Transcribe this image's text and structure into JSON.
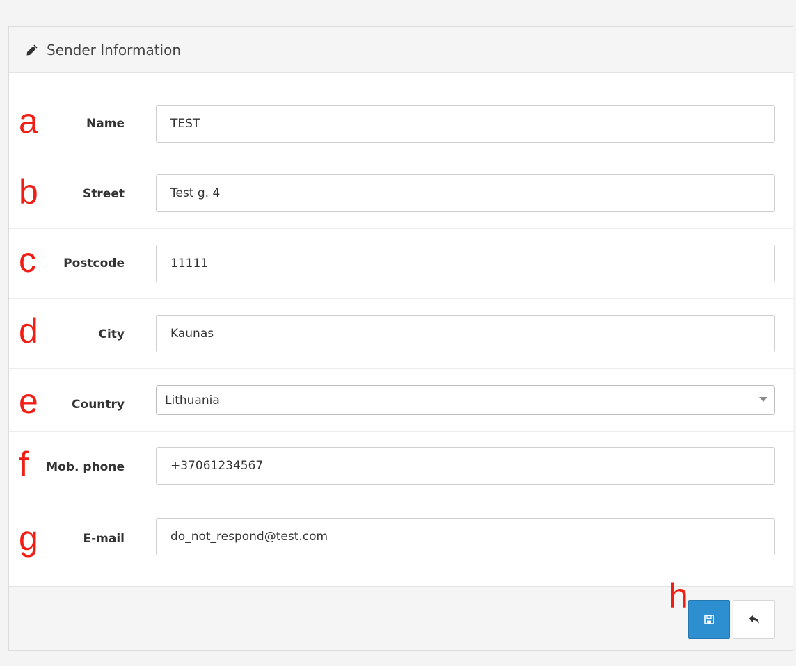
{
  "panel": {
    "title": "Sender Information",
    "title_icon": "pencil-icon"
  },
  "fields": [
    {
      "marker": "a",
      "label": "Name",
      "value": "TEST"
    },
    {
      "marker": "b",
      "label": "Street",
      "value": "Test g. 4"
    },
    {
      "marker": "c",
      "label": "Postcode",
      "value": "11111"
    },
    {
      "marker": "d",
      "label": "City",
      "value": "Kaunas"
    },
    {
      "marker": "e",
      "label": "Country",
      "value": "Lithuania"
    },
    {
      "marker": "f",
      "label": "Mob. phone",
      "value": "+37061234567"
    },
    {
      "marker": "g",
      "label": "E-mail",
      "value": "do_not_respond@test.com"
    }
  ],
  "footer": {
    "marker": "h",
    "save_icon": "floppy-disk-icon",
    "back_icon": "reply-arrow-icon"
  },
  "colors": {
    "accent": "#2d8fd0",
    "marker": "#f01e14"
  }
}
